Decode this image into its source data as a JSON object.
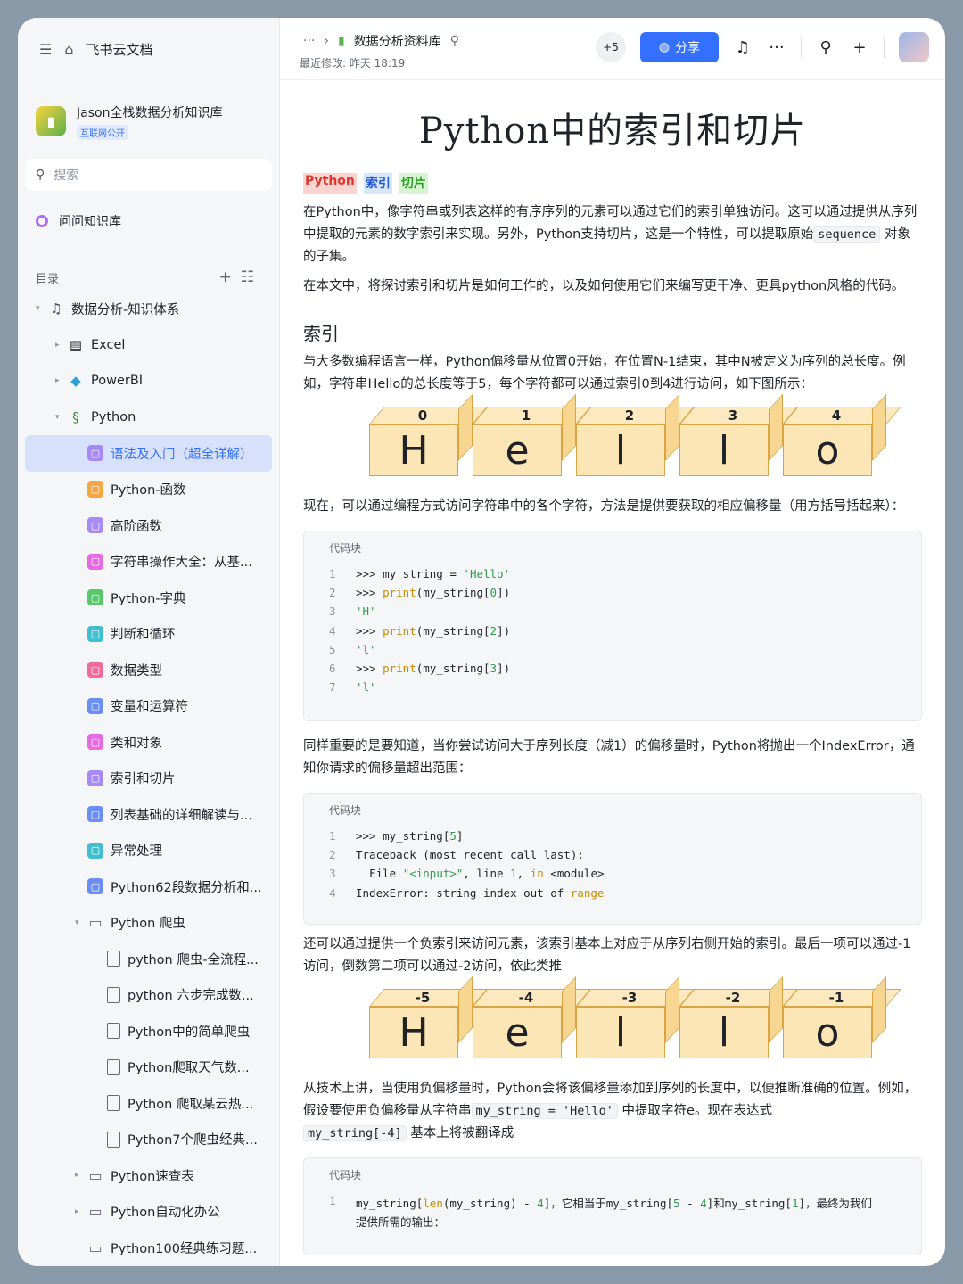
{
  "sidebar": {
    "app_name": "飞书云文档",
    "kb_title": "Jason全栈数据分析知识库",
    "kb_badge": "互联网公开",
    "search_placeholder": "搜索",
    "ask_label": "问问知识库",
    "toc_label": "目录",
    "tree": [
      {
        "label": "数据分析-知识体系",
        "indent": 0,
        "arrow": "▾",
        "icon": "music-icon",
        "color": "#3b4a5a"
      },
      {
        "label": "Excel",
        "indent": 1,
        "arrow": "▸",
        "icon": "excel-icon",
        "color": "#2c2c2c"
      },
      {
        "label": "PowerBI",
        "indent": 1,
        "arrow": "▸",
        "icon": "diamond-icon",
        "color": "#2b9fd8"
      },
      {
        "label": "Python",
        "indent": 1,
        "arrow": "▾",
        "icon": "python-icon",
        "color": "#3c8a3c"
      },
      {
        "label": "语法及入门（超全详解）",
        "indent": 2,
        "arrow": "",
        "icon": "page-icon",
        "color": "#a889f5",
        "active": true
      },
      {
        "label": "Python-函数",
        "indent": 2,
        "arrow": "",
        "icon": "page-icon",
        "color": "#f5a742"
      },
      {
        "label": "高阶函数",
        "indent": 2,
        "arrow": "",
        "icon": "page-icon",
        "color": "#a889f5"
      },
      {
        "label": "字符串操作大全：从基...",
        "indent": 2,
        "arrow": "",
        "icon": "page-icon",
        "color": "#e86ae0"
      },
      {
        "label": "Python-字典",
        "indent": 2,
        "arrow": "",
        "icon": "page-icon",
        "color": "#5ac76c"
      },
      {
        "label": "判断和循环",
        "indent": 2,
        "arrow": "",
        "icon": "page-icon",
        "color": "#3fbfcf"
      },
      {
        "label": "数据类型",
        "indent": 2,
        "arrow": "",
        "icon": "page-icon",
        "color": "#f06a9a"
      },
      {
        "label": "变量和运算符",
        "indent": 2,
        "arrow": "",
        "icon": "page-icon",
        "color": "#6b8ef5"
      },
      {
        "label": "类和对象",
        "indent": 2,
        "arrow": "",
        "icon": "page-icon",
        "color": "#e86ae0"
      },
      {
        "label": "索引和切片",
        "indent": 2,
        "arrow": "",
        "icon": "page-icon",
        "color": "#a889f5"
      },
      {
        "label": "列表基础的详细解读与...",
        "indent": 2,
        "arrow": "",
        "icon": "page-icon",
        "color": "#6b8ef5"
      },
      {
        "label": "异常处理",
        "indent": 2,
        "arrow": "",
        "icon": "page-icon",
        "color": "#3fbfcf"
      },
      {
        "label": "Python62段数据分析和...",
        "indent": 2,
        "arrow": "",
        "icon": "page-icon",
        "color": "#6b8ef5"
      },
      {
        "label": "Python 爬虫",
        "indent": 2,
        "arrow": "▾",
        "icon": "folder-icon",
        "color": "#646a73"
      },
      {
        "label": "python 爬虫-全流程...",
        "indent": 3,
        "arrow": "",
        "icon": "doc-icon",
        "color": "#646a73"
      },
      {
        "label": "python 六步完成数...",
        "indent": 3,
        "arrow": "",
        "icon": "doc-icon",
        "color": "#646a73"
      },
      {
        "label": "Python中的简单爬虫",
        "indent": 3,
        "arrow": "",
        "icon": "doc-icon",
        "color": "#646a73"
      },
      {
        "label": "Python爬取天气数...",
        "indent": 3,
        "arrow": "",
        "icon": "doc-icon",
        "color": "#646a73"
      },
      {
        "label": "Python 爬取某云热...",
        "indent": 3,
        "arrow": "",
        "icon": "doc-icon",
        "color": "#646a73"
      },
      {
        "label": "Python7个爬虫经典...",
        "indent": 3,
        "arrow": "",
        "icon": "doc-icon",
        "color": "#646a73"
      },
      {
        "label": "Python速查表",
        "indent": 2,
        "arrow": "▸",
        "icon": "folder-icon",
        "color": "#646a73"
      },
      {
        "label": "Python自动化办公",
        "indent": 2,
        "arrow": "▸",
        "icon": "folder-icon",
        "color": "#646a73"
      },
      {
        "label": "Python100经典练习题...",
        "indent": 2,
        "arrow": "",
        "icon": "folder-icon",
        "color": "#646a73"
      }
    ]
  },
  "header": {
    "breadcrumb_title": "数据分析资料库",
    "modified": "最近修改: 昨天 18:19",
    "collaborators": "+5",
    "share_label": "分享"
  },
  "doc": {
    "title": "Python中的索引和切片",
    "tags": [
      {
        "label": "Python",
        "bg": "#fbd4d0",
        "fg": "#d83931"
      },
      {
        "label": "索引",
        "bg": "#d9e7fd",
        "fg": "#245bdb"
      },
      {
        "label": "切片",
        "bg": "#d9f5d6",
        "fg": "#2ea121"
      }
    ],
    "p1a": "在Python中，像字符串或列表这样的有序序列的元素可以通过它们的索引单独访问。这可以通过提供从序列中提取的元素的数字索引来实现。另外，Python支持切片，这是一个特性，可以提取原始",
    "p1_code": "sequence",
    "p1b": "对象的子集。",
    "p2": "在本文中，将探讨索引和切片是如何工作的，以及如何使用它们来编写更干净、更具python风格的代码。",
    "h_index": "索引",
    "p3": "与大多数编程语言一样，Python偏移量从位置0开始，在位置N-1结束，其中N被定义为序列的总长度。例如，字符串Hello的总长度等于5，每个字符都可以通过索引0到4进行访问，如下图所示：",
    "boxes_pos": [
      {
        "idx": "0",
        "ch": "H"
      },
      {
        "idx": "1",
        "ch": "e"
      },
      {
        "idx": "2",
        "ch": "l"
      },
      {
        "idx": "3",
        "ch": "l"
      },
      {
        "idx": "4",
        "ch": "o"
      }
    ],
    "p4": "现在，可以通过编程方式访问字符串中的各个字符，方法是提供要获取的相应偏移量（用方括号括起来）：",
    "code_label": "代码块",
    "code1": [
      {
        "n": "1",
        "parts": [
          [
            "",
            ">>> my_string = "
          ],
          [
            "str",
            "'Hello'"
          ]
        ]
      },
      {
        "n": "2",
        "parts": [
          [
            "",
            ">>> "
          ],
          [
            "kw",
            "print"
          ],
          [
            "",
            "(my_string["
          ],
          [
            "num",
            "0"
          ],
          [
            "",
            "])"
          ]
        ]
      },
      {
        "n": "3",
        "parts": [
          [
            "str",
            "'H'"
          ]
        ]
      },
      {
        "n": "4",
        "parts": [
          [
            "",
            ">>> "
          ],
          [
            "kw",
            "print"
          ],
          [
            "",
            "(my_string["
          ],
          [
            "num",
            "2"
          ],
          [
            "",
            "])"
          ]
        ]
      },
      {
        "n": "5",
        "parts": [
          [
            "str",
            "'l'"
          ]
        ]
      },
      {
        "n": "6",
        "parts": [
          [
            "",
            ">>> "
          ],
          [
            "kw",
            "print"
          ],
          [
            "",
            "(my_string["
          ],
          [
            "num",
            "3"
          ],
          [
            "",
            "])"
          ]
        ]
      },
      {
        "n": "7",
        "parts": [
          [
            "str",
            "'l'"
          ]
        ]
      }
    ],
    "p5": "同样重要的是要知道，当你尝试访问大于序列长度（减1）的偏移量时，Python将抛出一个IndexError，通知你请求的偏移量超出范围：",
    "code2": [
      {
        "n": "1",
        "parts": [
          [
            "",
            ">>> my_string["
          ],
          [
            "num",
            "5"
          ],
          [
            "",
            "]"
          ]
        ]
      },
      {
        "n": "2",
        "parts": [
          [
            "",
            "Traceback (most recent call last):"
          ]
        ]
      },
      {
        "n": "3",
        "parts": [
          [
            "",
            "  File "
          ],
          [
            "str",
            "\"<input>\""
          ],
          [
            "",
            ", line "
          ],
          [
            "num",
            "1"
          ],
          [
            "",
            ", "
          ],
          [
            "kw",
            "in"
          ],
          [
            "",
            " <module>"
          ]
        ]
      },
      {
        "n": "4",
        "parts": [
          [
            "",
            "IndexError: string index out of "
          ],
          [
            "kw",
            "range"
          ]
        ]
      }
    ],
    "p6": "还可以通过提供一个负索引来访问元素，该索引基本上对应于从序列右侧开始的索引。最后一项可以通过-1访问，倒数第二项可以通过-2访问，依此类推",
    "boxes_neg": [
      {
        "idx": "-5",
        "ch": "H"
      },
      {
        "idx": "-4",
        "ch": "e"
      },
      {
        "idx": "-3",
        "ch": "l"
      },
      {
        "idx": "-2",
        "ch": "l"
      },
      {
        "idx": "-1",
        "ch": "o"
      }
    ],
    "p7a": "从技术上讲，当使用负偏移量时，Python会将该偏移量添加到序列的长度中，以便推断准确的位置。例如，假设要使用负偏移量从字符串",
    "p7_code1": "my_string = 'Hello'",
    "p7b": "中提取字符e。现在表达式",
    "p7_code2": "my_string[-4]",
    "p7c": "基本上将被翻译成",
    "code3_line1_parts": [
      [
        "",
        "my_string["
      ],
      [
        "kw",
        "len"
      ],
      [
        "",
        "(my_string) - "
      ],
      [
        "num",
        "4"
      ],
      [
        "",
        "]，它相当于my_string["
      ],
      [
        "num",
        "5"
      ],
      [
        "",
        " - "
      ],
      [
        "num",
        "4"
      ],
      [
        "",
        "]和my_string["
      ],
      [
        "num",
        "1"
      ],
      [
        "",
        "]，最终为我们"
      ]
    ],
    "code3_line2": "提供所需的输出："
  }
}
